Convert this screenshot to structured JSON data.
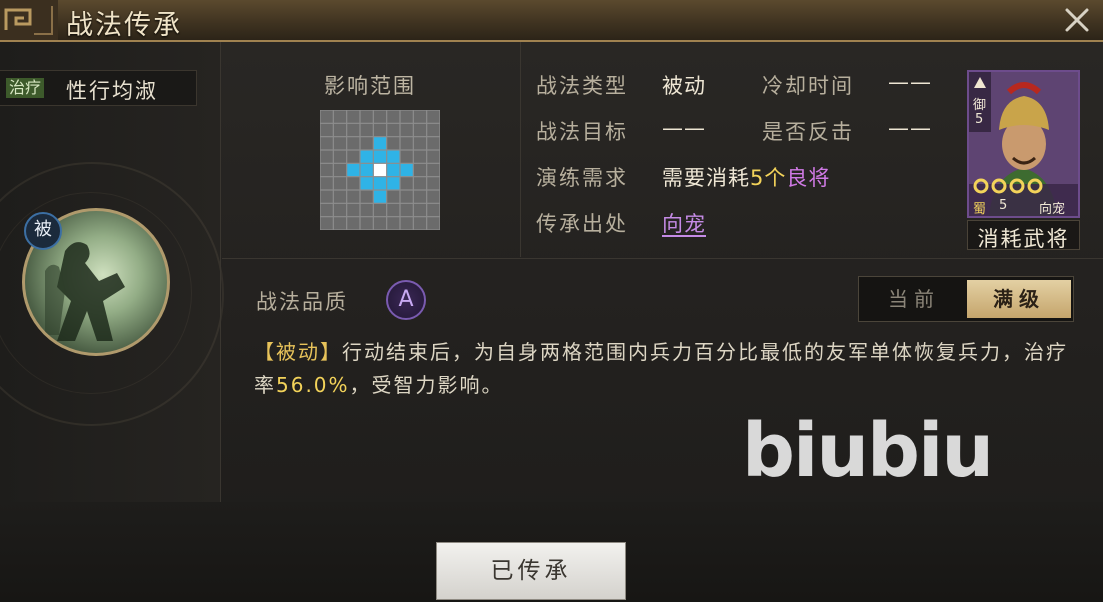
{
  "window": {
    "title": "战法传承"
  },
  "skill": {
    "tag": "治疗",
    "name": "性行均淑",
    "badge": "被",
    "range_label": "影响范围",
    "quality_label": "战法品质",
    "quality_grade": "A"
  },
  "info": {
    "type_label": "战法类型",
    "type_value": "被动",
    "cooldown_label": "冷却时间",
    "cooldown_value": "——",
    "target_label": "战法目标",
    "target_value": "——",
    "counter_label": "是否反击",
    "counter_value": "——",
    "train_label": "演练需求",
    "train_prefix": "需要消耗",
    "train_count": "5个",
    "train_item": "良将",
    "origin_label": "传承出处",
    "origin_value": "向宠"
  },
  "general_card": {
    "type": "御",
    "cost": "5",
    "faction": "蜀",
    "level": "5",
    "name": "向宠",
    "caption": "消耗武将"
  },
  "level_toggle": {
    "current": "当前",
    "max": "满级",
    "selected": "max"
  },
  "description": {
    "tag": "【被动】",
    "text_1": "行动结束后，为自身两格范围内兵力百分比最低的友军单体恢复兵力，治疗率",
    "rate": "56.0%",
    "text_2": "，受智力影响。"
  },
  "watermark": "biubiu",
  "action_button": "已传承",
  "colors": {
    "accent_gold": "#c5a56c",
    "highlight_yellow": "#f3d35a",
    "highlight_purple": "#d07ae6",
    "range_cyan": "#2fb3e6"
  }
}
